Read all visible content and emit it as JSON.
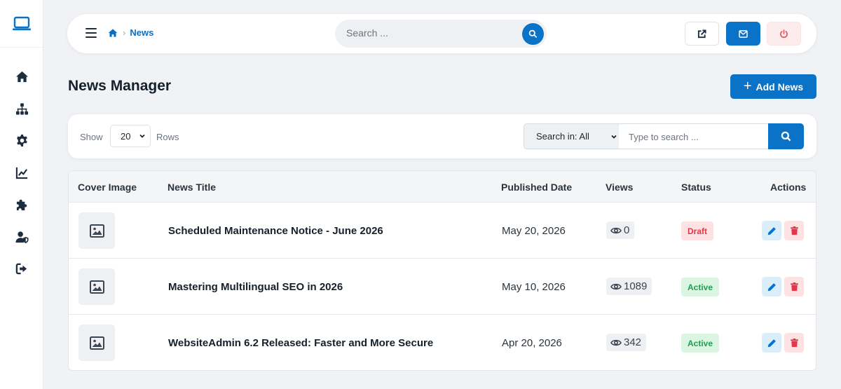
{
  "sidebar": {
    "logo_icon": "laptop-icon",
    "items": [
      {
        "icon": "home-icon"
      },
      {
        "icon": "sitemap-icon"
      },
      {
        "icon": "gear-icon"
      },
      {
        "icon": "chart-line-icon"
      },
      {
        "icon": "puzzle-icon"
      },
      {
        "icon": "user-shield-icon"
      },
      {
        "icon": "logout-icon"
      }
    ]
  },
  "topbar": {
    "breadcrumb": {
      "current": "News"
    },
    "search": {
      "placeholder": "Search ..."
    }
  },
  "page": {
    "title": "News Manager",
    "add_button": "Add News"
  },
  "filter": {
    "show_label": "Show",
    "rows_value": "20",
    "rows_label": "Rows",
    "scope_value": "Search in: All",
    "search_placeholder": "Type to search ..."
  },
  "table": {
    "columns": [
      "Cover Image",
      "News Title",
      "Published Date",
      "Views",
      "Status",
      "Actions"
    ],
    "rows": [
      {
        "title": "Scheduled Maintenance Notice - June 2026",
        "date": "May 20, 2026",
        "views": "0",
        "status": "Draft"
      },
      {
        "title": "Mastering Multilingual SEO in 2026",
        "date": "May 10, 2026",
        "views": "1089",
        "status": "Active"
      },
      {
        "title": "WebsiteAdmin 6.2 Released: Faster and More Secure",
        "date": "Apr 20, 2026",
        "views": "342",
        "status": "Active"
      }
    ]
  },
  "colors": {
    "primary": "#0a72c7",
    "danger": "#e0374a",
    "success": "#1f9e4e",
    "background": "#f1f2f5"
  }
}
